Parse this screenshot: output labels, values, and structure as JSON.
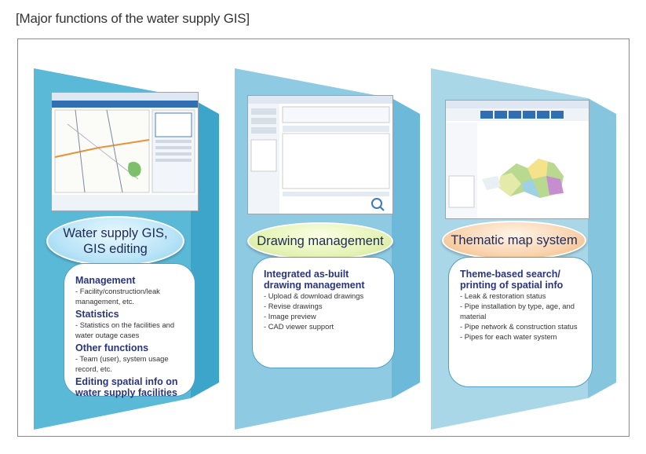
{
  "title": "[Major functions of the water supply GIS]",
  "colors": {
    "panel1": "#5bb9d8",
    "panel2": "#8ecbe3",
    "panel3": "#a9d7e8",
    "heading": "#2a3580"
  },
  "panels": [
    {
      "pill": [
        "Water supply GIS,",
        "GIS editing"
      ],
      "sections": [
        {
          "heading": [
            "Management"
          ],
          "items": [
            "- Facility/construction/leak management, etc."
          ]
        },
        {
          "heading": [
            "Statistics"
          ],
          "items": [
            "- Statistics on the facilities and water outage cases"
          ]
        },
        {
          "heading": [
            "Other functions"
          ],
          "items": [
            "- Team (user), system usage record, etc."
          ]
        },
        {
          "heading": [
            "Editing spatial info on",
            "water supply facilities"
          ],
          "items": []
        }
      ]
    },
    {
      "pill": [
        "Drawing management"
      ],
      "sections": [
        {
          "heading": [
            "Integrated as-built",
            "drawing management"
          ],
          "items": [
            "- Upload & download drawings",
            "- Revise drawings",
            "- Image preview",
            "- CAD viewer support"
          ]
        }
      ]
    },
    {
      "pill": [
        "Thematic map system"
      ],
      "sections": [
        {
          "heading": [
            "Theme-based search/",
            "printing of spatial info"
          ],
          "items": [
            "- Leak & restoration status",
            "- Pipe installation by type, age, and material",
            "- Pipe network & construction status",
            "- Pipes for each water system"
          ]
        }
      ]
    }
  ]
}
